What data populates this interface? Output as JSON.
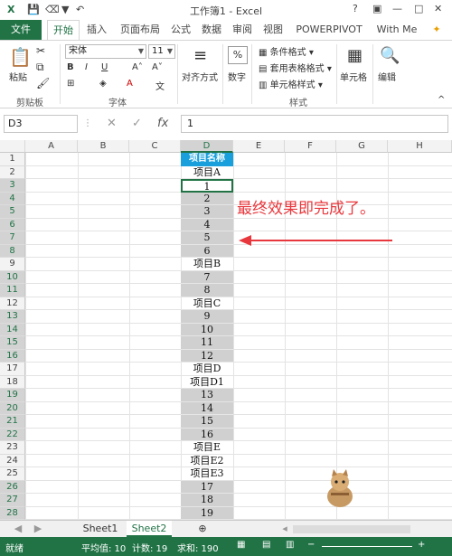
{
  "titlebar": {
    "title": "工作簿1 - Excel",
    "help": "?",
    "minimize": "—",
    "restore": "□",
    "close": "✕"
  },
  "tabs": [
    "文件",
    "开始",
    "插入",
    "页面布局",
    "公式",
    "数据",
    "审阅",
    "视图",
    "POWERPIVOT",
    "With Me"
  ],
  "ribbon": {
    "paste": "粘贴",
    "clipboard": "剪贴板",
    "font_name": "宋体",
    "font_size": "11",
    "font_group": "字体",
    "align": "对齐方式",
    "number": "数字",
    "cond_format": "条件格式",
    "table_format": "套用表格格式",
    "cell_style": "单元格样式",
    "styles_group": "样式",
    "cells": "单元格",
    "edit": "编辑"
  },
  "formula": {
    "name_box": "D3",
    "fx": "fx",
    "value": "1"
  },
  "columns": [
    "A",
    "B",
    "C",
    "D",
    "E",
    "F",
    "G",
    "H"
  ],
  "rows": [
    "1",
    "2",
    "3",
    "4",
    "5",
    "6",
    "7",
    "8",
    "9",
    "10",
    "11",
    "12",
    "13",
    "14",
    "15",
    "16",
    "17",
    "18",
    "19",
    "20",
    "21",
    "22",
    "23",
    "24",
    "25",
    "26",
    "27",
    "28"
  ],
  "column_d": [
    "项目名称",
    "项目A",
    "1",
    "2",
    "3",
    "4",
    "5",
    "6",
    "项目B",
    "7",
    "8",
    "项目C",
    "9",
    "10",
    "11",
    "12",
    "项目D",
    "项目D1",
    "13",
    "14",
    "15",
    "16",
    "项目E",
    "项目E2",
    "项目E3",
    "17",
    "18",
    "19"
  ],
  "annotation": "最终效果即完成了。",
  "sheets": [
    "Sheet1",
    "Sheet2"
  ],
  "status": {
    "ready": "就绪",
    "average": "平均值: 10",
    "count": "计数: 19",
    "sum": "求和: 190"
  },
  "colors": {
    "excel_green": "#217346",
    "header_blue": "#19a0dc",
    "annotation_red": "#e8383d",
    "fill_gray": "#d0d0d0"
  }
}
